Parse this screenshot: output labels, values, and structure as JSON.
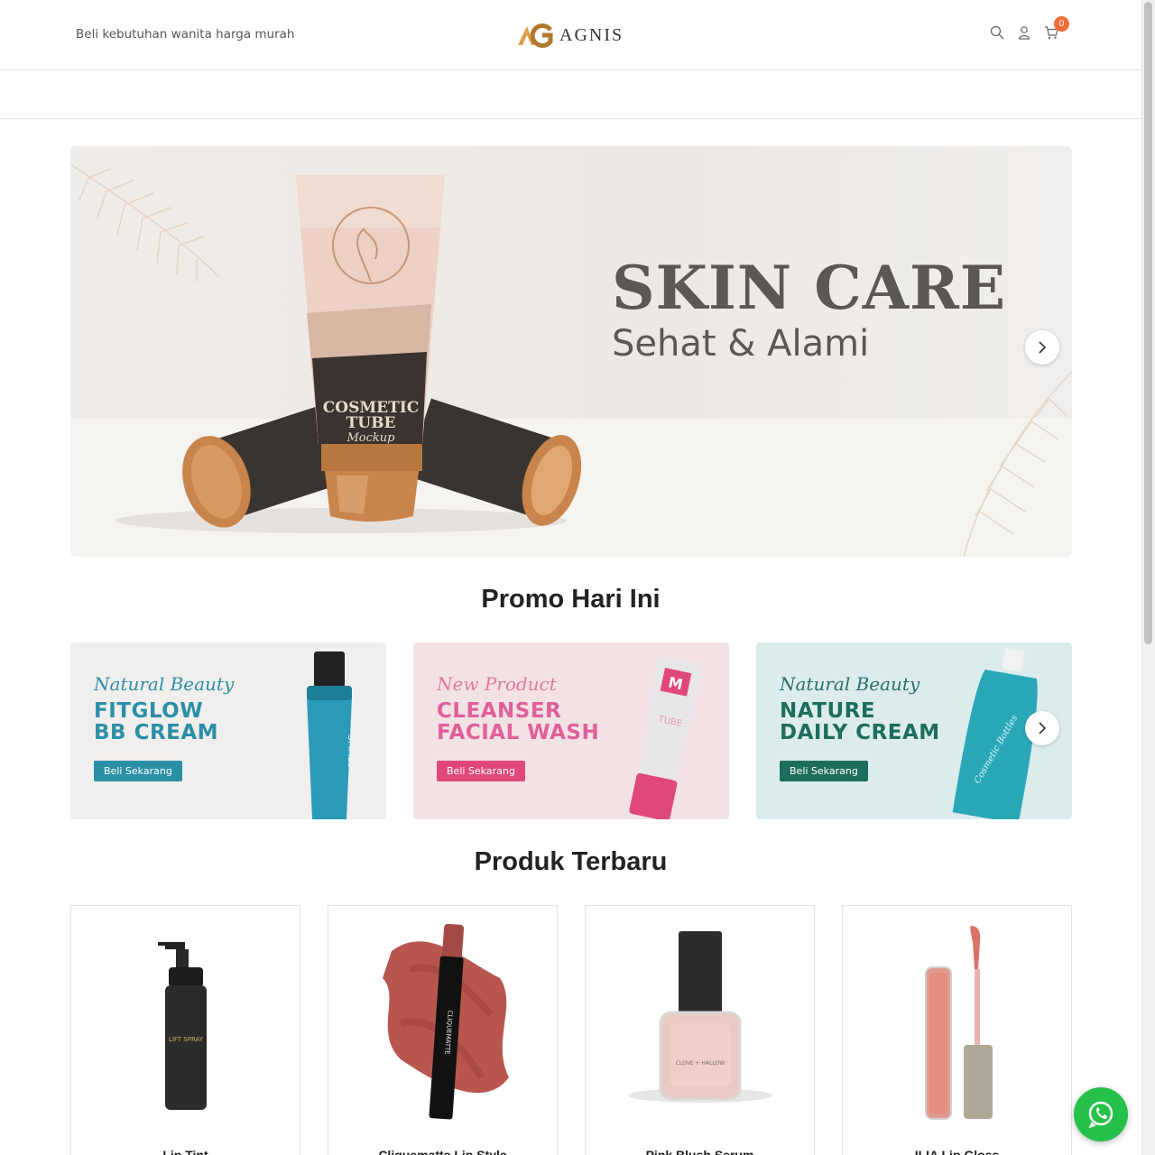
{
  "header": {
    "tagline": "Beli kebutuhan wanita harga murah",
    "brand": "AGNIS",
    "cart_count": "0",
    "icons": [
      "search-icon",
      "user-icon",
      "cart-icon"
    ]
  },
  "hero": {
    "title": "SKIN CARE",
    "subtitle": "Sehat & Alami",
    "tube_text": [
      "COSMETIC",
      "TUBE",
      "Mockup"
    ]
  },
  "promo_section": {
    "title": "Promo Hari Ini",
    "banners": [
      {
        "script": "Natural Beauty",
        "line1": "FITGLOW",
        "line2": "BB CREAM",
        "button": "Beli Sekarang",
        "bottle_text": "SMALL"
      },
      {
        "script": "New Product",
        "line1": "CLEANSER",
        "line2": "FACIAL WASH",
        "button": "Beli Sekarang",
        "bottle_text": "TUBE"
      },
      {
        "script": "Natural Beauty",
        "line1": "NATURE",
        "line2": "DAILY CREAM",
        "button": "Beli Sekarang",
        "bottle_text": "Cosmetic Bottles"
      }
    ]
  },
  "products_section": {
    "title": "Produk Terbaru",
    "items": [
      {
        "name": "Lip Tint"
      },
      {
        "name": "Cliquematte Lip Style"
      },
      {
        "name": "Pink Blush Serum"
      },
      {
        "name": "ILIA Lip Gloss"
      }
    ]
  },
  "colors": {
    "accent": "#f26b3a",
    "promo1": "#2b8fa6",
    "promo2": "#e0487a",
    "promo3": "#1d6e5a",
    "whatsapp": "#25c14a"
  }
}
